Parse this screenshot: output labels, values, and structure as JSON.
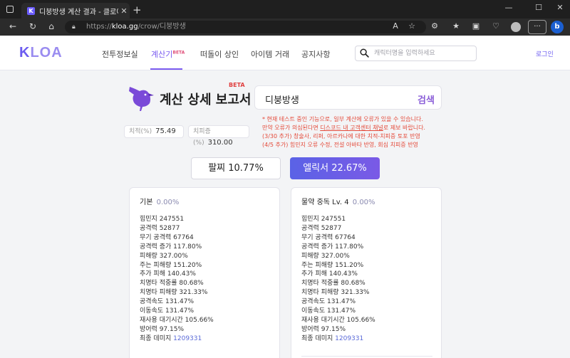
{
  "browser": {
    "tab_title": "디붕방생 계산 결과 - 클로아",
    "url_host": "kloa.gg",
    "url_path": "/crow/디붕방생",
    "url_scheme": "https://"
  },
  "site": {
    "logo_k": "K",
    "logo_rest": "LOA",
    "nav": [
      {
        "label": "전투정보실"
      },
      {
        "label": "계산기",
        "badge": "BETA"
      },
      {
        "label": "떠돌이 상인"
      },
      {
        "label": "아이템 거래"
      },
      {
        "label": "공지사항"
      }
    ],
    "search_placeholder": "캐릭터명을 입력하세요",
    "login_label": "로그인"
  },
  "report": {
    "title": "계산 상세 보고서",
    "beta": "BETA",
    "character_name": "디붕방생",
    "search_button": "검색",
    "crit_label": "치적(%)",
    "crit_value": "75.49",
    "critdmg_label": "치피증(%)",
    "critdmg_value": "310.00",
    "notice": {
      "line1": "* 현재 테스트 중인 기능으로, 일부 계산에 오류가 있을 수 있습니다.",
      "line2_pre": "만약 오류가 의심된다면 ",
      "line2_link": "디스코드 내 고객센터 채널",
      "line2_post": "로 제보 바랍니다.",
      "line3": "(3/30 추가) 창술사, 리퍼, 아르카나에 대한 치적-치피증 토포 반영",
      "line4": "(4/5 추가) 힘민지 오류 수정, 전설 아바타 반영, 회심 치피증 반영"
    },
    "potion_button": "팔찌 10.77%",
    "elixir_button": "엘릭서 22.67%"
  },
  "cards": [
    {
      "title": "기본",
      "pct": "0.00%",
      "stats": [
        "힘민지 247551",
        "공격력 52877",
        "무기 공격력 67764",
        "공격력 증가 117.80%",
        "피해량 327.00%",
        "주는 피해량 151.20%",
        "추가 피해 140.43%",
        "치명타 적중률 80.68%",
        "치명타 피해량 321.33%",
        "공격속도 131.47%",
        "이동속도 131.47%",
        "재사용 대기시간 105.66%",
        "방어력 97.15%"
      ],
      "final_label": "최종 데미지",
      "final_value": "1209331"
    },
    {
      "title": "물약 중독 Lv. 4",
      "pct": "0.00%",
      "stats": [
        "힘민지 247551",
        "공격력 52877",
        "무기 공격력 67764",
        "공격력 증가 117.80%",
        "피해량 327.00%",
        "주는 피해량 151.20%",
        "추가 피해 140.43%",
        "치명타 적중률 80.68%",
        "치명타 피해량 321.33%",
        "공격속도 131.47%",
        "이동속도 131.47%",
        "재사용 대기시간 105.66%",
        "방어력 97.15%"
      ],
      "final_label": "최종 데미지",
      "final_value": "1209331"
    }
  ]
}
